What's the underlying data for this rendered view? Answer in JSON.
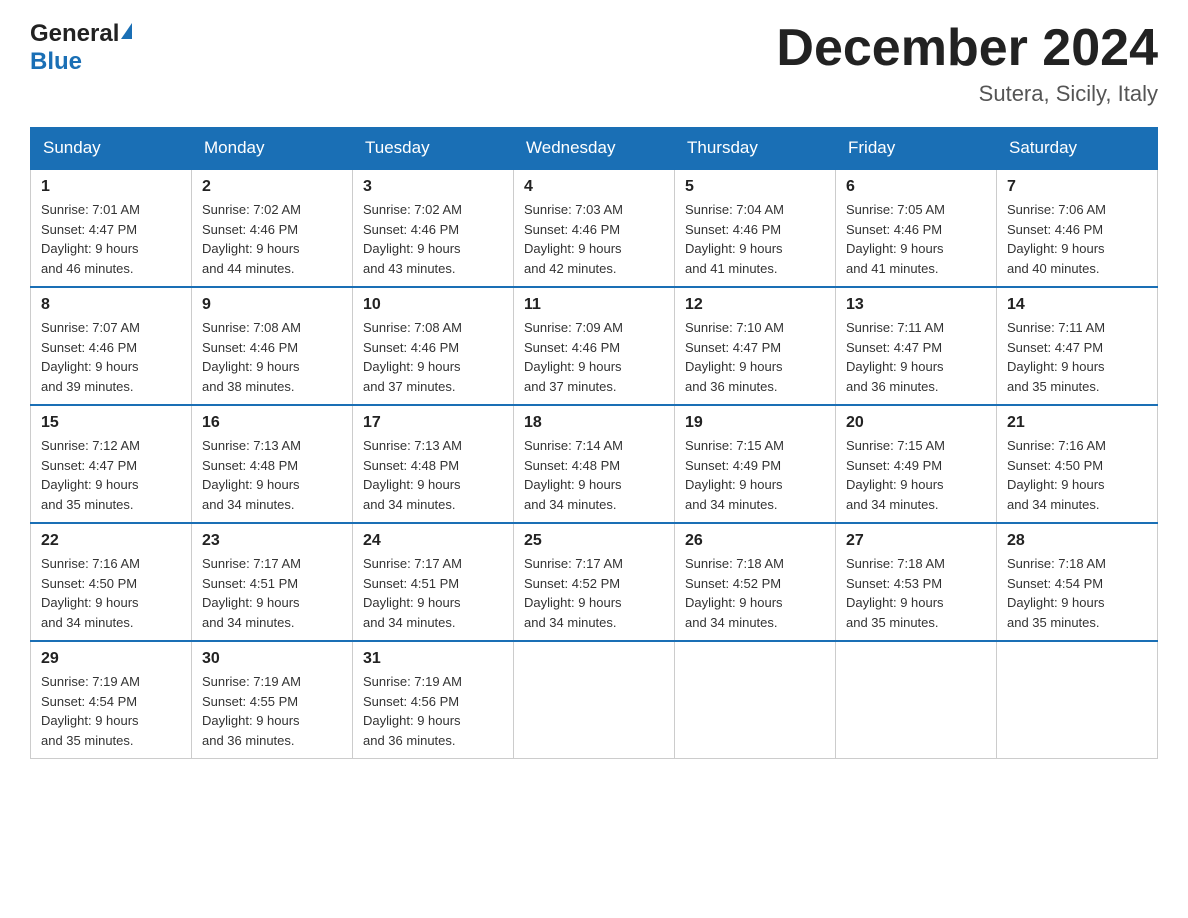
{
  "header": {
    "logo_general": "General",
    "logo_blue": "Blue",
    "month_title": "December 2024",
    "location": "Sutera, Sicily, Italy"
  },
  "weekdays": [
    "Sunday",
    "Monday",
    "Tuesday",
    "Wednesday",
    "Thursday",
    "Friday",
    "Saturday"
  ],
  "weeks": [
    [
      {
        "day": "1",
        "sunrise": "7:01 AM",
        "sunset": "4:47 PM",
        "daylight": "9 hours and 46 minutes."
      },
      {
        "day": "2",
        "sunrise": "7:02 AM",
        "sunset": "4:46 PM",
        "daylight": "9 hours and 44 minutes."
      },
      {
        "day": "3",
        "sunrise": "7:02 AM",
        "sunset": "4:46 PM",
        "daylight": "9 hours and 43 minutes."
      },
      {
        "day": "4",
        "sunrise": "7:03 AM",
        "sunset": "4:46 PM",
        "daylight": "9 hours and 42 minutes."
      },
      {
        "day": "5",
        "sunrise": "7:04 AM",
        "sunset": "4:46 PM",
        "daylight": "9 hours and 41 minutes."
      },
      {
        "day": "6",
        "sunrise": "7:05 AM",
        "sunset": "4:46 PM",
        "daylight": "9 hours and 41 minutes."
      },
      {
        "day": "7",
        "sunrise": "7:06 AM",
        "sunset": "4:46 PM",
        "daylight": "9 hours and 40 minutes."
      }
    ],
    [
      {
        "day": "8",
        "sunrise": "7:07 AM",
        "sunset": "4:46 PM",
        "daylight": "9 hours and 39 minutes."
      },
      {
        "day": "9",
        "sunrise": "7:08 AM",
        "sunset": "4:46 PM",
        "daylight": "9 hours and 38 minutes."
      },
      {
        "day": "10",
        "sunrise": "7:08 AM",
        "sunset": "4:46 PM",
        "daylight": "9 hours and 37 minutes."
      },
      {
        "day": "11",
        "sunrise": "7:09 AM",
        "sunset": "4:46 PM",
        "daylight": "9 hours and 37 minutes."
      },
      {
        "day": "12",
        "sunrise": "7:10 AM",
        "sunset": "4:47 PM",
        "daylight": "9 hours and 36 minutes."
      },
      {
        "day": "13",
        "sunrise": "7:11 AM",
        "sunset": "4:47 PM",
        "daylight": "9 hours and 36 minutes."
      },
      {
        "day": "14",
        "sunrise": "7:11 AM",
        "sunset": "4:47 PM",
        "daylight": "9 hours and 35 minutes."
      }
    ],
    [
      {
        "day": "15",
        "sunrise": "7:12 AM",
        "sunset": "4:47 PM",
        "daylight": "9 hours and 35 minutes."
      },
      {
        "day": "16",
        "sunrise": "7:13 AM",
        "sunset": "4:48 PM",
        "daylight": "9 hours and 34 minutes."
      },
      {
        "day": "17",
        "sunrise": "7:13 AM",
        "sunset": "4:48 PM",
        "daylight": "9 hours and 34 minutes."
      },
      {
        "day": "18",
        "sunrise": "7:14 AM",
        "sunset": "4:48 PM",
        "daylight": "9 hours and 34 minutes."
      },
      {
        "day": "19",
        "sunrise": "7:15 AM",
        "sunset": "4:49 PM",
        "daylight": "9 hours and 34 minutes."
      },
      {
        "day": "20",
        "sunrise": "7:15 AM",
        "sunset": "4:49 PM",
        "daylight": "9 hours and 34 minutes."
      },
      {
        "day": "21",
        "sunrise": "7:16 AM",
        "sunset": "4:50 PM",
        "daylight": "9 hours and 34 minutes."
      }
    ],
    [
      {
        "day": "22",
        "sunrise": "7:16 AM",
        "sunset": "4:50 PM",
        "daylight": "9 hours and 34 minutes."
      },
      {
        "day": "23",
        "sunrise": "7:17 AM",
        "sunset": "4:51 PM",
        "daylight": "9 hours and 34 minutes."
      },
      {
        "day": "24",
        "sunrise": "7:17 AM",
        "sunset": "4:51 PM",
        "daylight": "9 hours and 34 minutes."
      },
      {
        "day": "25",
        "sunrise": "7:17 AM",
        "sunset": "4:52 PM",
        "daylight": "9 hours and 34 minutes."
      },
      {
        "day": "26",
        "sunrise": "7:18 AM",
        "sunset": "4:52 PM",
        "daylight": "9 hours and 34 minutes."
      },
      {
        "day": "27",
        "sunrise": "7:18 AM",
        "sunset": "4:53 PM",
        "daylight": "9 hours and 35 minutes."
      },
      {
        "day": "28",
        "sunrise": "7:18 AM",
        "sunset": "4:54 PM",
        "daylight": "9 hours and 35 minutes."
      }
    ],
    [
      {
        "day": "29",
        "sunrise": "7:19 AM",
        "sunset": "4:54 PM",
        "daylight": "9 hours and 35 minutes."
      },
      {
        "day": "30",
        "sunrise": "7:19 AM",
        "sunset": "4:55 PM",
        "daylight": "9 hours and 36 minutes."
      },
      {
        "day": "31",
        "sunrise": "7:19 AM",
        "sunset": "4:56 PM",
        "daylight": "9 hours and 36 minutes."
      },
      null,
      null,
      null,
      null
    ]
  ],
  "labels": {
    "sunrise": "Sunrise:",
    "sunset": "Sunset:",
    "daylight": "Daylight:"
  }
}
